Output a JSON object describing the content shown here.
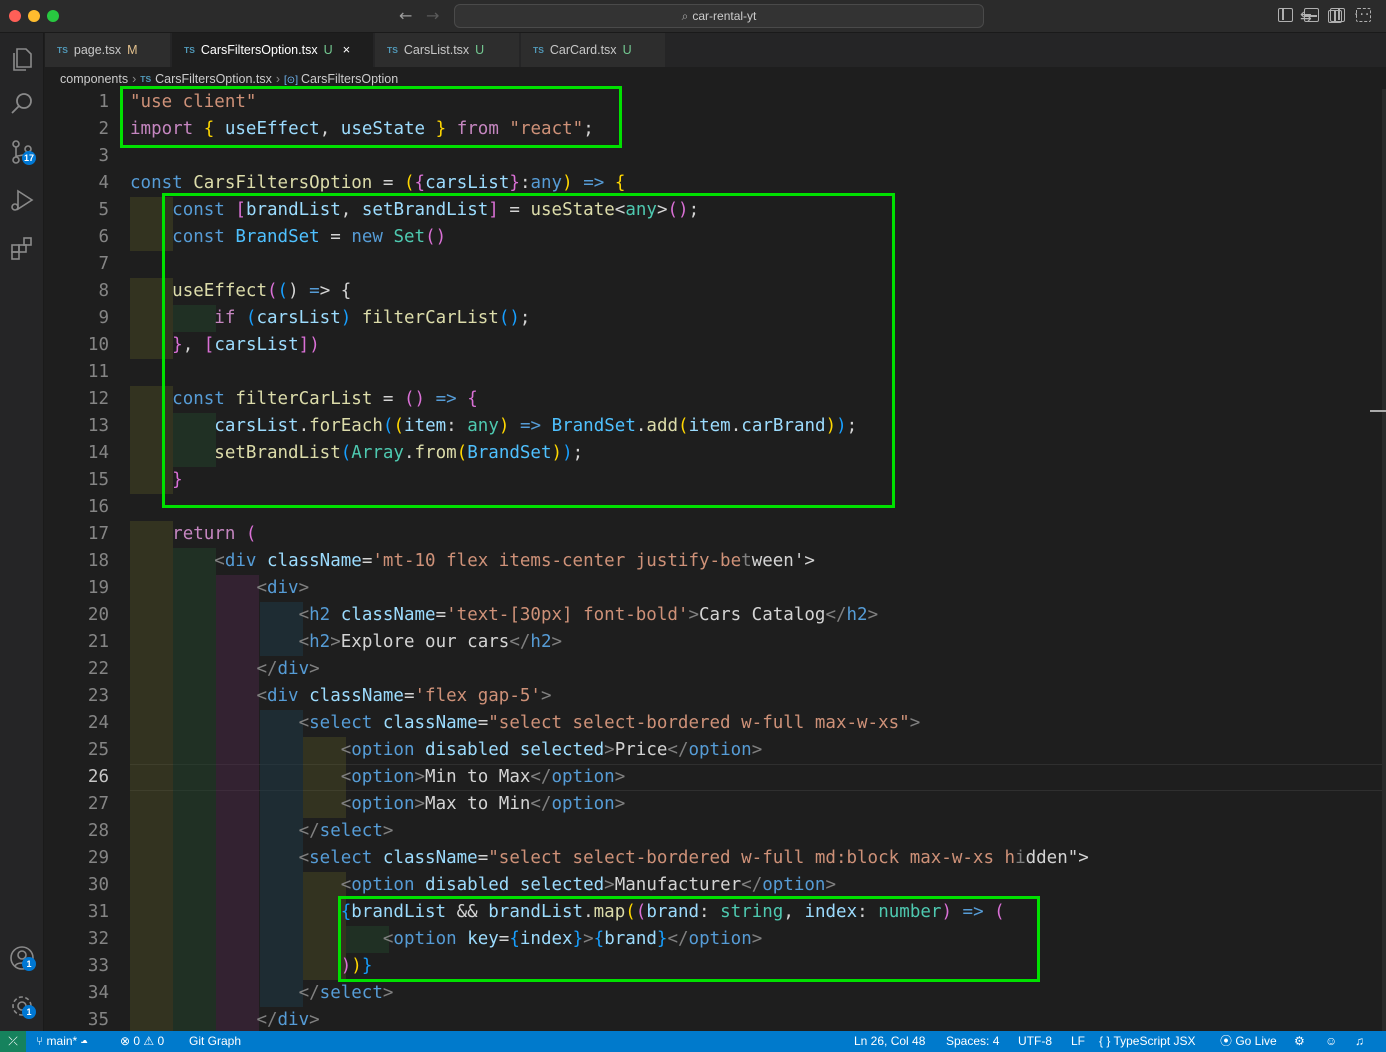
{
  "window": {
    "title": "car-rental-yt"
  },
  "tabs": [
    {
      "label": "page.tsx",
      "type": "TS",
      "status": "M"
    },
    {
      "label": "CarsFiltersOption.tsx",
      "type": "TS",
      "status": "U",
      "active": true
    },
    {
      "label": "CarsList.tsx",
      "type": "TS",
      "status": "U"
    },
    {
      "label": "CarCard.tsx",
      "type": "TS",
      "status": "U"
    }
  ],
  "breadcrumb": [
    "components",
    "CarsFiltersOption.tsx",
    "CarsFiltersOption"
  ],
  "activity": {
    "scm_badge": "17",
    "accounts_badge": "1",
    "settings_badge": "1"
  },
  "editor": {
    "active_line": 26,
    "line_numbers": [
      "1",
      "2",
      "3",
      "4",
      "5",
      "6",
      "7",
      "8",
      "9",
      "10",
      "11",
      "12",
      "13",
      "14",
      "15",
      "16",
      "17",
      "18",
      "19",
      "20",
      "21",
      "22",
      "23",
      "24",
      "25",
      "26",
      "27",
      "28",
      "29",
      "30",
      "31",
      "32",
      "33",
      "34",
      "35"
    ],
    "lines": [
      "\"use client\"",
      "import { useEffect, useState } from \"react\";",
      "",
      "const CarsFiltersOption = ({carsList}:any) => {",
      "    const [brandList, setBrandList] = useState<any>();",
      "    const BrandSet = new Set()",
      "",
      "    useEffect(() => {",
      "        if (carsList) filterCarList();",
      "    }, [carsList])",
      "",
      "    const filterCarList = () => {",
      "        carsList.forEach((item: any) => BrandSet.add(item.carBrand));",
      "        setBrandList(Array.from(BrandSet));",
      "    }",
      "",
      "    return (",
      "        <div className='mt-10 flex items-center justify-between'>",
      "            <div>",
      "                <h2 className='text-[30px] font-bold'>Cars Catalog</h2>",
      "                <h2>Explore our cars</h2>",
      "            </div>",
      "            <div className='flex gap-5'>",
      "                <select className=\"select select-bordered w-full max-w-xs\">",
      "                    <option disabled selected>Price</option>",
      "                    <option>Min to Max</option>",
      "                    <option>Max to Min</option>",
      "                </select>",
      "                <select className=\"select select-bordered w-full md:block max-w-xs hidden\">",
      "                    <option disabled selected>Manufacturer</option>",
      "                    {brandList && brandList.map((brand: string, index: number) => (",
      "                        <option key={index}>{brand}</option>",
      "                    ))}",
      "                </select>",
      "            </div>"
    ]
  },
  "statusbar": {
    "branch": "main*",
    "errors": "0",
    "warnings": "0",
    "git_graph": "Git Graph",
    "position": "Ln 26, Col 48",
    "spaces": "Spaces: 4",
    "encoding": "UTF-8",
    "eol": "LF",
    "language": "TypeScript JSX",
    "go_live": "Go Live"
  },
  "colors": {
    "highlight_box": "#00e000",
    "statusbar": "#007acc",
    "editor_bg": "#1e1e1e"
  }
}
